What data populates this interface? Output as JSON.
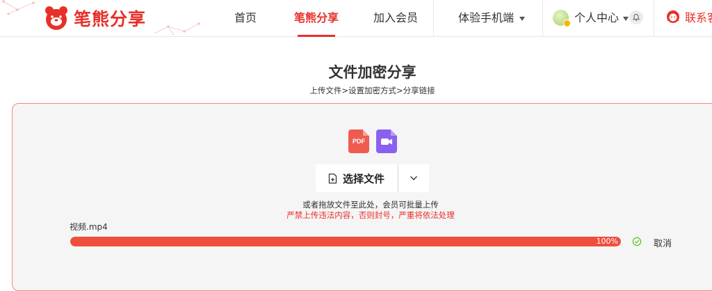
{
  "header": {
    "logo_text": "笔熊分享",
    "nav": [
      {
        "label": "首页"
      },
      {
        "label": "笔熊分享",
        "active": true
      },
      {
        "label": "加入会员"
      },
      {
        "label": "体验手机端"
      }
    ],
    "user_center": "个人中心",
    "contact": "联系客"
  },
  "page": {
    "title": "文件加密分享",
    "steps": "上传文件>设置加密方式>分享链接"
  },
  "upload": {
    "pdf_icon_label": "PDF",
    "select_label": "选择文件",
    "hint": "或者拖放文件至此处，会员可批量上传",
    "warning": "严禁上传违法内容，否则封号，严重将依法处理",
    "file": {
      "name": "视频.mp4",
      "progress_percent": 100,
      "progress_label": "100%",
      "cancel_label": "取消"
    }
  },
  "colors": {
    "brand": "#e8302a",
    "progress": "#f04e3c",
    "pdf": "#ef5b4f",
    "video": "#8a61ef"
  }
}
